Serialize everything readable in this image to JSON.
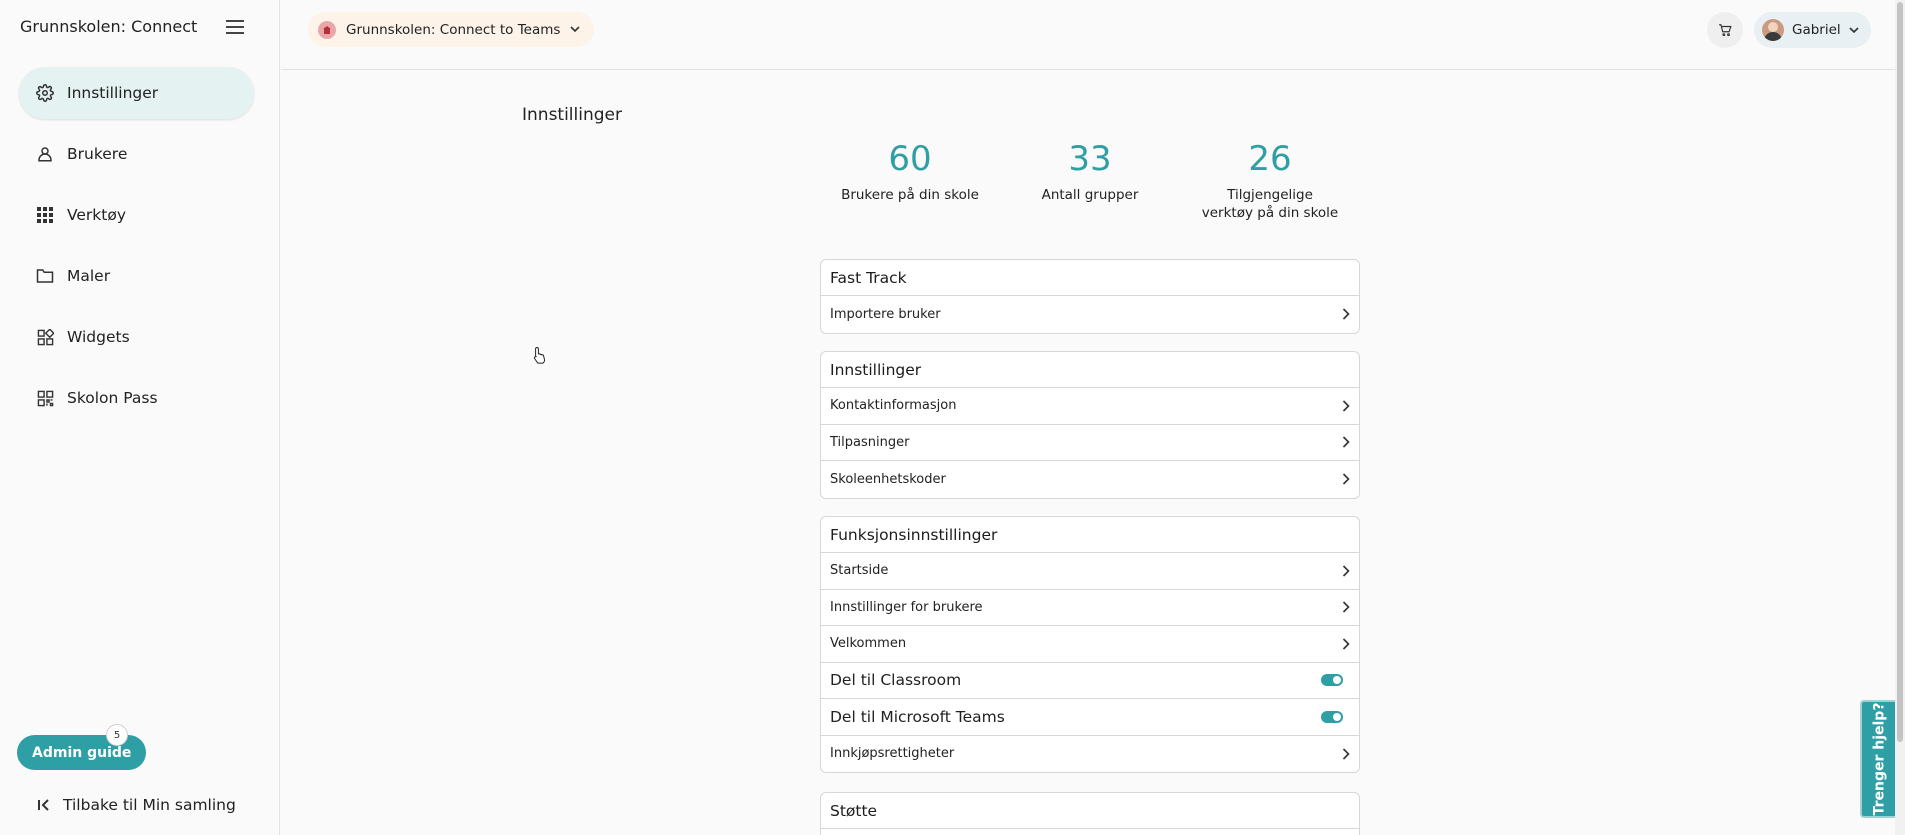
{
  "sidebar": {
    "brand": "Grunnskolen: Connect t...",
    "items": [
      {
        "label": "Innstillinger",
        "icon": "gear-icon",
        "active": true
      },
      {
        "label": "Brukere",
        "icon": "person-icon"
      },
      {
        "label": "Verktøy",
        "icon": "apps-grid-icon"
      },
      {
        "label": "Maler",
        "icon": "folder-icon"
      },
      {
        "label": "Widgets",
        "icon": "widgets-icon"
      },
      {
        "label": "Skolon Pass",
        "icon": "qr-code-icon"
      }
    ],
    "admin_guide": {
      "label": "Admin guide",
      "badge": "5"
    },
    "back_label": "Tilbake til Min samling"
  },
  "topbar": {
    "school": "Grunnskolen: Connect to Teams",
    "user": "Gabriel"
  },
  "main": {
    "title": "Innstillinger",
    "stats": [
      {
        "value": "60",
        "label": "Brukere på din skole"
      },
      {
        "value": "33",
        "label": "Antall grupper"
      },
      {
        "value": "26",
        "label": "Tilgjengelige verktøy på din skole"
      }
    ],
    "sections": [
      {
        "title": "Fast Track",
        "rows": [
          "Importere bruker"
        ]
      },
      {
        "title": "Innstillinger",
        "rows": [
          "Kontaktinformasjon",
          "Tilpasninger",
          "Skoleenhetskoder"
        ]
      },
      {
        "title": "Funksjonsinnstillinger",
        "rows": [
          "Startside",
          "Innstillinger for brukere",
          "Velkommen"
        ],
        "toggles": [
          {
            "label": "Del til Classroom",
            "on": true
          },
          {
            "label": "Del til Microsoft Teams",
            "on": true
          }
        ],
        "last_row": "Innkjøpsrettigheter"
      },
      {
        "title": "Støtte"
      }
    ]
  },
  "help": {
    "label": "Trenger hjelp?"
  },
  "colors": {
    "accent": "#2e9fa5",
    "active_bg": "#e4f2f2"
  }
}
